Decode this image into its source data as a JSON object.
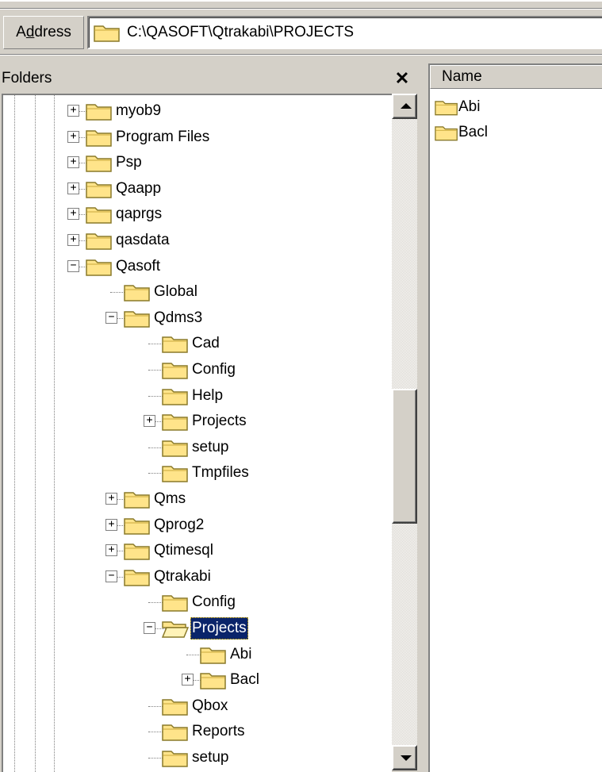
{
  "address": {
    "label_pre": "A",
    "label_accel": "d",
    "label_post": "dress",
    "path": "C:\\QASOFT\\Qtrakabi\\PROJECTS",
    "icon": "folder-icon"
  },
  "folders_pane": {
    "title": "Folders",
    "close_glyph": "✕",
    "tree": [
      {
        "label": "myob9",
        "expander": "+"
      },
      {
        "label": "Program Files",
        "expander": "+"
      },
      {
        "label": "Psp",
        "expander": "+"
      },
      {
        "label": "Qaapp",
        "expander": "+"
      },
      {
        "label": "qaprgs",
        "expander": "+"
      },
      {
        "label": "qasdata",
        "expander": "+"
      },
      {
        "label": "Qasoft",
        "expander": "−"
      },
      {
        "label": "Global",
        "expander": ""
      },
      {
        "label": "Qdms3",
        "expander": "−"
      },
      {
        "label": "Cad",
        "expander": ""
      },
      {
        "label": "Config",
        "expander": ""
      },
      {
        "label": "Help",
        "expander": ""
      },
      {
        "label": "Projects",
        "expander": "+"
      },
      {
        "label": "setup",
        "expander": ""
      },
      {
        "label": "Tmpfiles",
        "expander": ""
      },
      {
        "label": "Qms",
        "expander": "+"
      },
      {
        "label": "Qprog2",
        "expander": "+"
      },
      {
        "label": "Qtimesql",
        "expander": "+"
      },
      {
        "label": "Qtrakabi",
        "expander": "−"
      },
      {
        "label": "Config",
        "expander": ""
      },
      {
        "label": "Projects",
        "expander": "−",
        "selected": true
      },
      {
        "label": "Abi",
        "expander": ""
      },
      {
        "label": "Bacl",
        "expander": "+"
      },
      {
        "label": "Qbox",
        "expander": ""
      },
      {
        "label": "Reports",
        "expander": ""
      },
      {
        "label": "setup",
        "expander": ""
      }
    ]
  },
  "list_pane": {
    "column_name": "Name",
    "items": [
      {
        "label": "Abi",
        "icon": "folder-icon"
      },
      {
        "label": "Bacl",
        "icon": "folder-icon"
      }
    ]
  },
  "colors": {
    "window_bg": "#d4d0c8",
    "selection_bg": "#0a246a",
    "folder_fill": "#ffe48a",
    "folder_stroke": "#8a7a2a"
  }
}
